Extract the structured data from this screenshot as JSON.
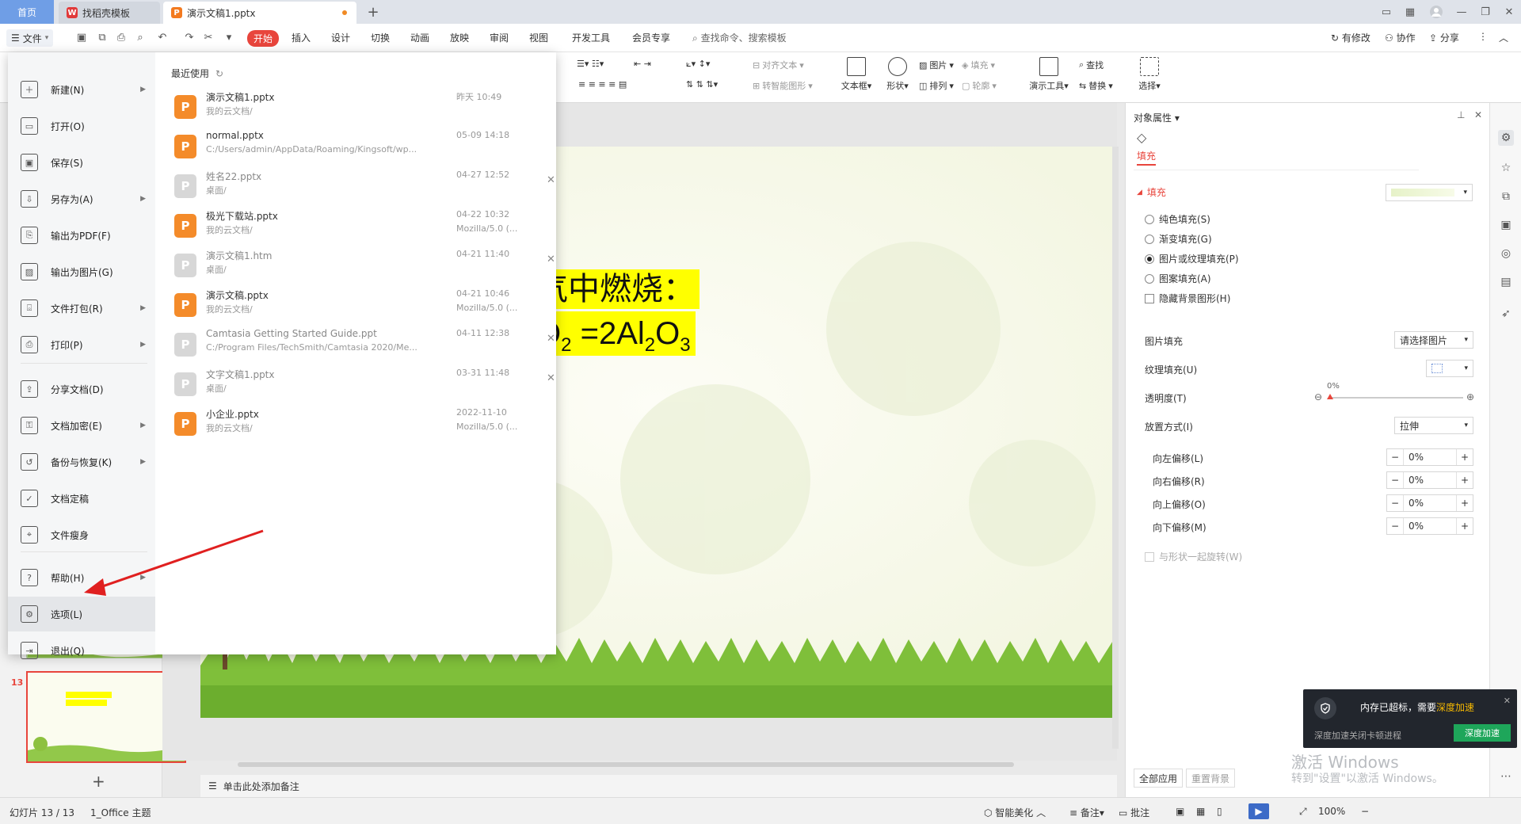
{
  "titlebar": {
    "home_tab": "首页",
    "template_tab": "找稻壳模板",
    "doc_tab": "演示文稿1.pptx"
  },
  "menubar": {
    "file": "文件",
    "tabs": [
      "开始",
      "插入",
      "设计",
      "切换",
      "动画",
      "放映",
      "审阅",
      "视图",
      "开发工具",
      "会员专享"
    ],
    "search": "查找命令、搜索模板",
    "right_actions": [
      "有修改",
      "协作",
      "分享"
    ]
  },
  "ribbon": {
    "align_text": "对齐文本",
    "smart_shape": "转智能图形",
    "textbox": "文本框",
    "shape": "形状",
    "picture": "图片",
    "fill": "填充",
    "arrange": "排列",
    "outline": "轮廓",
    "present_tool": "演示工具",
    "find": "查找",
    "replace": "替换",
    "select": "选择"
  },
  "file_menu": {
    "items": [
      {
        "label": "新建(N)",
        "arrow": true
      },
      {
        "label": "打开(O)",
        "arrow": false
      },
      {
        "label": "保存(S)",
        "arrow": false
      },
      {
        "label": "另存为(A)",
        "arrow": true
      },
      {
        "label": "输出为PDF(F)",
        "arrow": false
      },
      {
        "label": "输出为图片(G)",
        "arrow": false
      },
      {
        "label": "文件打包(R)",
        "arrow": true
      },
      {
        "label": "打印(P)",
        "arrow": true
      },
      {
        "label": "分享文档(D)",
        "arrow": false
      },
      {
        "label": "文档加密(E)",
        "arrow": true
      },
      {
        "label": "备份与恢复(K)",
        "arrow": true
      },
      {
        "label": "文档定稿",
        "arrow": false
      },
      {
        "label": "文件瘦身",
        "arrow": false
      },
      {
        "label": "帮助(H)",
        "arrow": true
      },
      {
        "label": "选项(L)",
        "arrow": false
      },
      {
        "label": "退出(Q)",
        "arrow": false
      }
    ],
    "recent_title": "最近使用",
    "recent": [
      {
        "name": "演示文稿1.pptx",
        "path": "我的云文档/",
        "time": "昨天  10:49",
        "source": "",
        "kind": "ppt",
        "x": false
      },
      {
        "name": "normal.pptx",
        "path": "C:/Users/admin/AppData/Roaming/Kingsoft/wp...",
        "time": "05-09  14:18",
        "source": "",
        "kind": "ppt",
        "x": false
      },
      {
        "name": "姓名22.pptx",
        "path": "桌面/",
        "time": "04-27  12:52",
        "source": "",
        "kind": "gray",
        "x": true
      },
      {
        "name": "极光下载站.pptx",
        "path": "我的云文档/",
        "time": "04-22  10:32",
        "source": "Mozilla/5.0 (...",
        "kind": "ppt",
        "x": false
      },
      {
        "name": "演示文稿1.htm",
        "path": "桌面/",
        "time": "04-21  11:40",
        "source": "",
        "kind": "gray",
        "x": true
      },
      {
        "name": "演示文稿.pptx",
        "path": "我的云文档/",
        "time": "04-21  10:46",
        "source": "Mozilla/5.0 (...",
        "kind": "ppt",
        "x": false
      },
      {
        "name": "Camtasia Getting Started Guide.ppt",
        "path": "C:/Program Files/TechSmith/Camtasia 2020/Me...",
        "time": "04-11  12:38",
        "source": "",
        "kind": "gray",
        "x": true
      },
      {
        "name": "文字文稿1.pptx",
        "path": "桌面/",
        "time": "03-31  11:48",
        "source": "",
        "kind": "gray",
        "x": true
      },
      {
        "name": "小企业.pptx",
        "path": "我的云文档/",
        "time": "2022-11-10",
        "source": "Mozilla/5.0 (...",
        "kind": "ppt",
        "x": false
      }
    ]
  },
  "slide": {
    "line1": "气中燃烧：",
    "line2_a": "O",
    "line2_sub1": "2",
    "line2_b": " =2Al",
    "line2_sub2": "2",
    "line2_c": "O",
    "line2_sub3": "3",
    "thumb_number": "13",
    "notes_placeholder": "单击此处添加备注"
  },
  "props": {
    "title": "对象属性",
    "tab_fill": "填充",
    "section_fill": "填充",
    "fill_options": [
      {
        "label": "纯色填充(S)",
        "checked": false
      },
      {
        "label": "渐变填充(G)",
        "checked": false
      },
      {
        "label": "图片或纹理填充(P)",
        "checked": true
      },
      {
        "label": "图案填充(A)",
        "checked": false
      }
    ],
    "hide_bg": "隐藏背景图形(H)",
    "picture_fill_label": "图片填充",
    "picture_fill_value": "请选择图片",
    "texture_fill_label": "纹理填充(U)",
    "transparency_label": "透明度(T)",
    "transparency_value": "0%",
    "placement_label": "放置方式(I)",
    "placement_value": "拉伸",
    "offsets": [
      {
        "label": "向左偏移(L)",
        "value": "0%"
      },
      {
        "label": "向右偏移(R)",
        "value": "0%"
      },
      {
        "label": "向上偏移(O)",
        "value": "0%"
      },
      {
        "label": "向下偏移(M)",
        "value": "0%"
      }
    ],
    "rotate_with_shape": "与形状一起旋转(W)",
    "apply_all": "全部应用",
    "reset_bg": "重置背景"
  },
  "notification": {
    "title_a": "内存已超标，需要",
    "title_link": "深度加速",
    "desc": "深度加速关闭卡顿进程",
    "button": "深度加速"
  },
  "watermark": {
    "line1": "激活 Windows",
    "line2": "转到\"设置\"以激活 Windows。"
  },
  "statusbar": {
    "slide_count": "幻灯片 13 / 13",
    "theme": "1_Office 主题",
    "smart_beautify": "智能美化",
    "notes": "备注",
    "comments": "批注",
    "zoom": "100%"
  },
  "colors": {
    "accent": "#e8453c",
    "home_tab": "#6f9ee6",
    "ppt_orange": "#f48b2a",
    "highlight_yellow": "#ffff00",
    "notify_green": "#1ea65a",
    "notify_link": "#f5b800"
  }
}
